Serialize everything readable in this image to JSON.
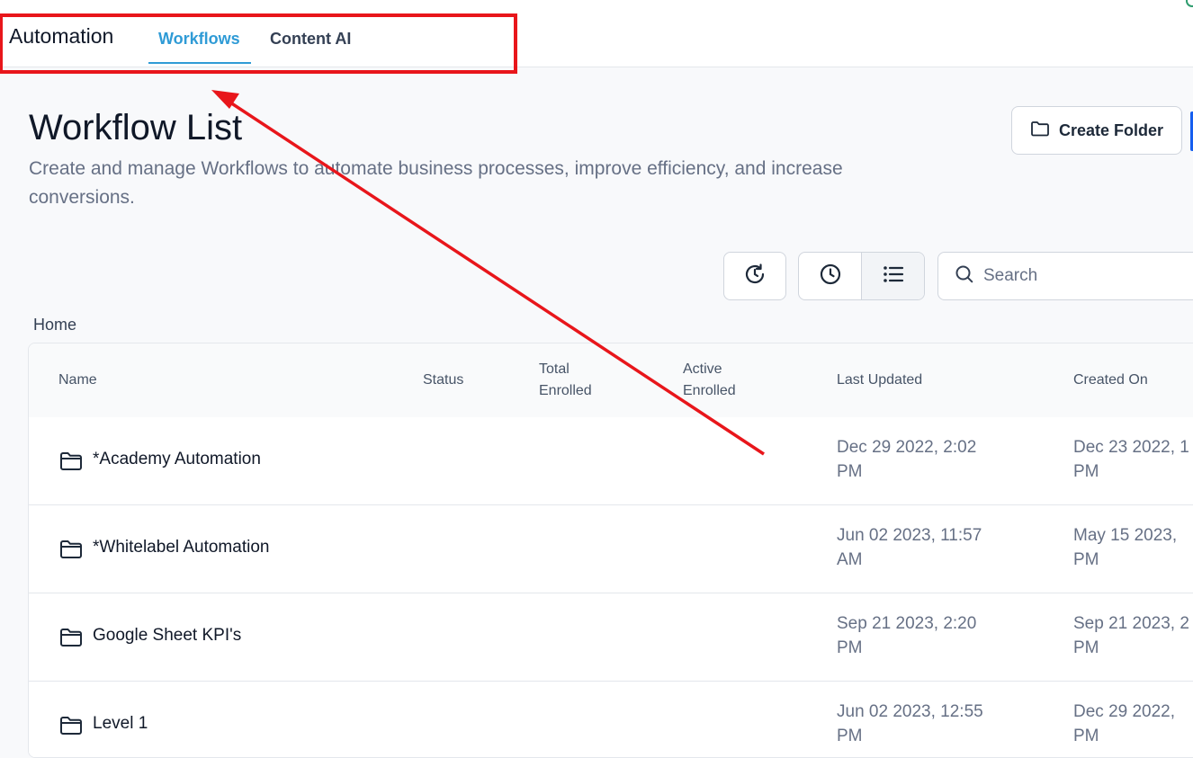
{
  "header": {
    "app_title": "Automation",
    "tabs": [
      {
        "label": "Workflows",
        "active": true
      },
      {
        "label": "Content AI",
        "active": false
      }
    ]
  },
  "page": {
    "title": "Workflow List",
    "description": "Create and manage Workflows to automate business processes, improve efficiency, and increase conversions."
  },
  "toolbar": {
    "create_folder_label": "Create Folder",
    "search_placeholder": "Search"
  },
  "breadcrumb": "Home",
  "table": {
    "columns": [
      "Name",
      "Status",
      "Total\nEnrolled",
      "Active\nEnrolled",
      "Last Updated",
      "Created On"
    ],
    "rows": [
      {
        "name": "*Academy Automation",
        "last_updated": "Dec 29 2022, 2:02\nPM",
        "created_on": "Dec 23 2022, 1\nPM"
      },
      {
        "name": "*Whitelabel Automation",
        "last_updated": "Jun 02 2023, 11:57\nAM",
        "created_on": "May 15 2023,\nPM"
      },
      {
        "name": "Google Sheet KPI's",
        "last_updated": "Sep 21 2023, 2:20\nPM",
        "created_on": "Sep 21 2023, 2\nPM"
      },
      {
        "name": "Level 1",
        "last_updated": "Jun 02 2023, 12:55\nPM",
        "created_on": "Dec 29 2022,\nPM"
      }
    ]
  },
  "colors": {
    "accent": "#2f9bd6",
    "annotation": "#e8161b"
  },
  "icons": [
    "history-icon",
    "clock-icon",
    "list-icon",
    "search-icon",
    "folder-icon"
  ]
}
